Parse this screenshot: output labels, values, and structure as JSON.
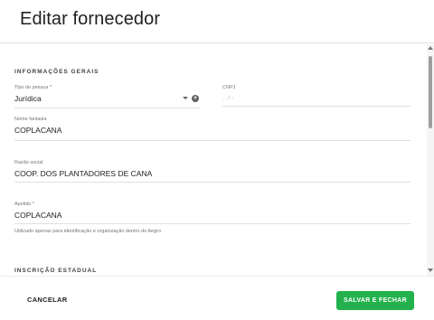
{
  "dialog": {
    "title": "Editar fornecedor"
  },
  "sections": {
    "general": "INFORMAÇÕES GERAIS",
    "state_registration": "INSCRIÇÃO ESTADUAL"
  },
  "fields": {
    "person_type": {
      "label": "Tipo de pessoa *",
      "value": "Jurídica"
    },
    "cnpj": {
      "label": "CNPJ",
      "value": ".  .   /   -"
    },
    "trade_name": {
      "label": "Nome fantasia",
      "value": "COPLACANA"
    },
    "company_name": {
      "label": "Razão social",
      "value": "COOP. DOS PLANTADORES DE CANA"
    },
    "nickname": {
      "label": "Apelido *",
      "value": "COPLACANA",
      "hint": "Utilizado apenas para identificação e organização dentro do Aegro"
    }
  },
  "footer": {
    "cancel_label": "CANCELAR",
    "save_label": "SALVAR E FECHAR"
  },
  "colors": {
    "primary": "#22b14c"
  }
}
